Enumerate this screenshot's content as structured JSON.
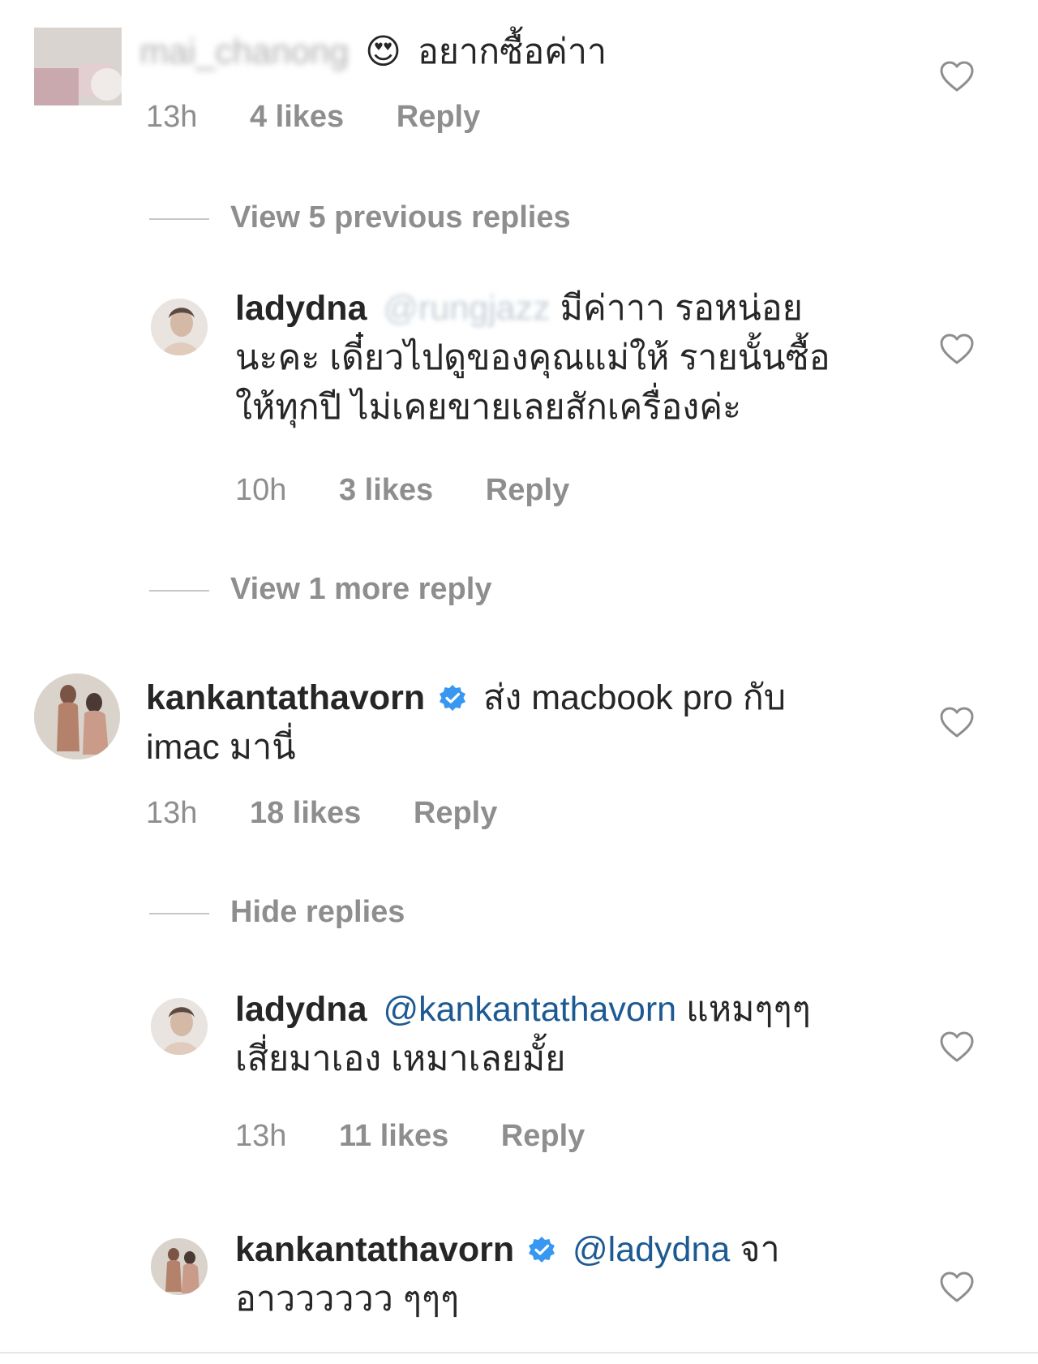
{
  "comments": [
    {
      "username": "mai_chanong",
      "emoji": "😍",
      "text": "อยากซื้อค่าา",
      "time": "13h",
      "likes": "4 likes",
      "reply": "Reply"
    },
    {
      "username": "ladydna",
      "mention": "@rungjazz",
      "text_line1": "มีค่าาา รอหน่อย",
      "text_line2": "นะคะ เดี๋ยวไปดูของคุณแม่ให้ รายนั้นซื้อ",
      "text_line3": "ให้ทุกปี ไม่เคยขายเลยสักเครื่องค่ะ",
      "time": "10h",
      "likes": "3 likes",
      "reply": "Reply"
    },
    {
      "username": "kankantathavorn",
      "text_line1": "ส่ง macbook pro กับ",
      "text_line2": "imac มานี่",
      "time": "13h",
      "likes": "18 likes",
      "reply": "Reply"
    },
    {
      "username": "ladydna",
      "mention": "@kankantathavorn",
      "text_line1": "แหมๆๆๆ",
      "text_line2": "เสี่ยมาเอง เหมาเลยมั้ย",
      "time": "13h",
      "likes": "11 likes",
      "reply": "Reply"
    },
    {
      "username": "kankantathavorn",
      "mention": "@ladydna",
      "text_line1": "จา",
      "text_line2": "อาวววววว ๆๆๆ"
    }
  ],
  "toggles": {
    "view_previous": "View 5 previous replies",
    "view_more": "View 1 more reply",
    "hide": "Hide replies"
  },
  "icons": {
    "like": "heart-outline-icon",
    "verified": "verified-badge-icon"
  },
  "colors": {
    "text": "#262626",
    "meta": "#8e8e8e",
    "mention": "#1d5a93",
    "verified": "#3897f0"
  }
}
